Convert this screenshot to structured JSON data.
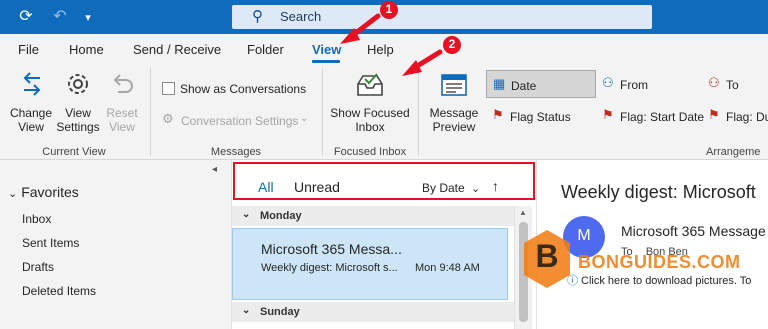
{
  "titlebar": {
    "search_placeholder": "Search",
    "refresh_icon": "refresh-icon",
    "undo_icon": "undo-icon",
    "qat_icon": "customize-dropdown-icon"
  },
  "menu": {
    "tabs": [
      "File",
      "Home",
      "Send / Receive",
      "Folder",
      "View",
      "Help"
    ],
    "active_tab": "View"
  },
  "ribbon": {
    "change_view": "Change\nView",
    "change_view_line1": "Change",
    "change_view_line2": "View",
    "view_settings_line1": "View",
    "view_settings_line2": "Settings",
    "reset_view_line1": "Reset",
    "reset_view_line2": "View",
    "show_as_conversations": "Show as Conversations",
    "conversation_settings": "Conversation Settings",
    "show_focused_inbox_line1": "Show Focused",
    "show_focused_inbox_line2": "Inbox",
    "message_preview_line1": "Message",
    "message_preview_line2": "Preview",
    "groups": {
      "current_view": "Current View",
      "messages": "Messages",
      "focused_inbox": "Focused Inbox",
      "arrangement": "Arrangeme"
    },
    "arrangement": {
      "date": "Date",
      "from": "From",
      "to": "To",
      "flag_status": "Flag Status",
      "flag_start_date": "Flag: Start Date",
      "flag_due": "Flag: Du"
    }
  },
  "annotations": {
    "callout_1": "1",
    "callout_2": "2"
  },
  "folders": {
    "favorites": "Favorites",
    "items": [
      "Inbox",
      "Sent Items",
      "Drafts",
      "Deleted Items"
    ]
  },
  "message_list": {
    "filter_all": "All",
    "filter_unread": "Unread",
    "sort_by": "By Date",
    "groups": [
      {
        "day": "Monday",
        "messages": [
          {
            "sender": "Microsoft 365 Messa...",
            "subject": "Weekly digest: Microsoft s...",
            "time": "Mon 9:48 AM"
          }
        ]
      },
      {
        "day": "Sunday",
        "messages": []
      }
    ]
  },
  "reading_pane": {
    "subject": "Weekly digest: Microsoft",
    "avatar_initial": "M",
    "sender": "Microsoft 365 Message",
    "to_label": "To",
    "to_value": "Bon Ben",
    "download_notice": "Click here to download pictures. To"
  },
  "watermark": {
    "letter": "B",
    "text": "BONGUIDES.COM"
  },
  "colors": {
    "brand": "#0f6cbd",
    "selected_message": "#cde6f7",
    "annotation_red": "#e81123",
    "watermark_orange": "#f07d14"
  }
}
